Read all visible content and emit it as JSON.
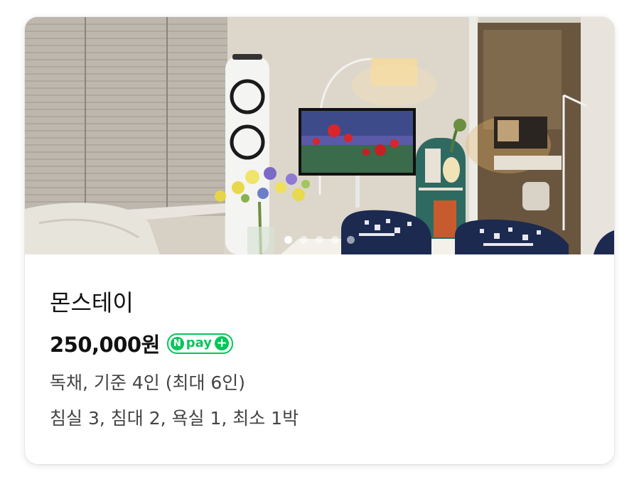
{
  "listing": {
    "name": "몬스테이",
    "price": "250,000원",
    "pay_badge": {
      "icon_letter": "N",
      "label": "pay",
      "plus": "+",
      "color": "#03c75a"
    },
    "detail_line_1": "독채, 기준 4인 (최대 6인)",
    "detail_line_2": "침실 3, 침대 2, 욕실 1, 최소 1박"
  },
  "carousel": {
    "slide_count": 5,
    "active_index": 0
  },
  "icons": {
    "photo": "room-photo",
    "pay": "npay-icon"
  }
}
